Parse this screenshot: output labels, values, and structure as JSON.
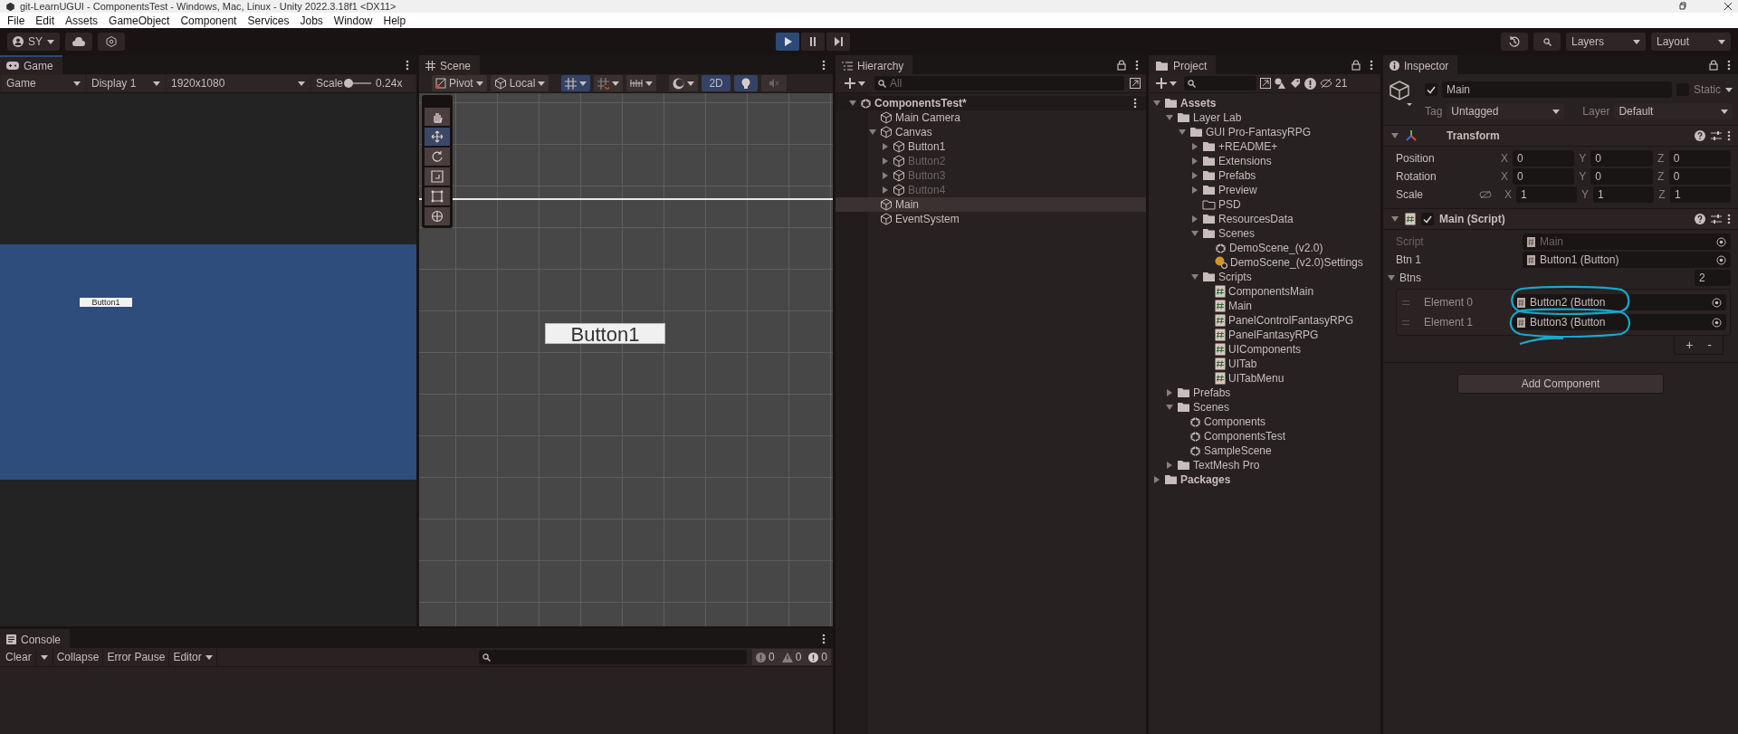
{
  "window": {
    "title": "git-LearnUGUI - ComponentsTest - Windows, Mac, Linux - Unity 2022.3.18f1 <DX11>"
  },
  "menu": [
    "File",
    "Edit",
    "Assets",
    "GameObject",
    "Component",
    "Services",
    "Jobs",
    "Window",
    "Help"
  ],
  "toolbar": {
    "account": "SY",
    "layers": "Layers",
    "layout": "Layout"
  },
  "play_controls": [
    {
      "kind": "play",
      "selected": true
    },
    {
      "kind": "pause",
      "selected": false
    },
    {
      "kind": "step",
      "selected": false
    }
  ],
  "game": {
    "tab": "Game",
    "view_mode": "Game",
    "display": "Display 1",
    "resolution": "1920x1080",
    "scale_label": "Scale",
    "scale_slider": {
      "level": 0.05
    },
    "scale": "0.24x",
    "button_text": "Button1"
  },
  "scene": {
    "tab": "Scene",
    "pivot": "Pivot",
    "local": "Local",
    "mode_2d": {
      "label": "2D",
      "selected": true
    },
    "lighting": {
      "selected": true
    },
    "audio": {
      "selected": false
    },
    "button_text": "Button1",
    "tools": [
      {
        "kind": "hand",
        "selected": false
      },
      {
        "kind": "move",
        "selected": true
      },
      {
        "kind": "rotate",
        "selected": false
      },
      {
        "kind": "scale",
        "selected": false
      },
      {
        "kind": "rect",
        "selected": false
      },
      {
        "kind": "transform",
        "selected": false
      }
    ]
  },
  "hierarchy": {
    "tab": "Hierarchy",
    "search_placeholder": "All",
    "tree": [
      {
        "label": "ComponentsTest*",
        "kind": "scene",
        "expanded": true,
        "selected": false,
        "disabled": false,
        "children": [
          {
            "label": "Main Camera",
            "kind": "object",
            "selected": false,
            "disabled": false
          },
          {
            "label": "Canvas",
            "kind": "object",
            "expanded": true,
            "selected": false,
            "disabled": false,
            "children": [
              {
                "label": "Button1",
                "kind": "object",
                "expanded": false,
                "selected": false,
                "disabled": false
              },
              {
                "label": "Button2",
                "kind": "object",
                "expanded": false,
                "selected": false,
                "disabled": true
              },
              {
                "label": "Button3",
                "kind": "object",
                "expanded": false,
                "selected": false,
                "disabled": true
              },
              {
                "label": "Button4",
                "kind": "object",
                "expanded": false,
                "selected": false,
                "disabled": true
              }
            ]
          },
          {
            "label": "Main",
            "kind": "object",
            "selected": true,
            "disabled": false
          },
          {
            "label": "EventSystem",
            "kind": "object",
            "selected": false,
            "disabled": false
          }
        ]
      }
    ]
  },
  "project": {
    "tab": "Project",
    "hidden_count": "21",
    "tree": [
      {
        "label": "Assets",
        "kind": "folder",
        "expanded": true,
        "children": [
          {
            "label": "Layer Lab",
            "kind": "folder",
            "expanded": true,
            "children": [
              {
                "label": "GUI Pro-FantasyRPG",
                "kind": "folder",
                "expanded": true,
                "children": [
                  {
                    "label": "+README+",
                    "kind": "folder",
                    "expanded": false
                  },
                  {
                    "label": "Extensions",
                    "kind": "folder",
                    "expanded": false
                  },
                  {
                    "label": "Prefabs",
                    "kind": "folder",
                    "expanded": false
                  },
                  {
                    "label": "Preview",
                    "kind": "folder",
                    "expanded": false
                  },
                  {
                    "label": "PSD",
                    "kind": "empty_folder"
                  },
                  {
                    "label": "ResourcesData",
                    "kind": "folder",
                    "expanded": false
                  },
                  {
                    "label": "Scenes",
                    "kind": "folder",
                    "expanded": true,
                    "children": [
                      {
                        "label": "DemoScene_(v2.0)",
                        "kind": "scene"
                      },
                      {
                        "label": "DemoScene_(v2.0)Settings",
                        "kind": "settings"
                      }
                    ]
                  },
                  {
                    "label": "Scripts",
                    "kind": "folder",
                    "expanded": true,
                    "children": [
                      {
                        "label": "ComponentsMain",
                        "kind": "script"
                      },
                      {
                        "label": "Main",
                        "kind": "script"
                      },
                      {
                        "label": "PanelControlFantasyRPG",
                        "kind": "script"
                      },
                      {
                        "label": "PanelFantasyRPG",
                        "kind": "script"
                      },
                      {
                        "label": "UIComponents",
                        "kind": "script"
                      },
                      {
                        "label": "UITab",
                        "kind": "script"
                      },
                      {
                        "label": "UITabMenu",
                        "kind": "script"
                      }
                    ]
                  }
                ]
              }
            ]
          },
          {
            "label": "Prefabs",
            "kind": "folder",
            "expanded": false
          },
          {
            "label": "Scenes",
            "kind": "folder",
            "expanded": true,
            "children": [
              {
                "label": "Components",
                "kind": "scene"
              },
              {
                "label": "ComponentsTest",
                "kind": "scene"
              },
              {
                "label": "SampleScene",
                "kind": "scene"
              }
            ]
          },
          {
            "label": "TextMesh Pro",
            "kind": "folder",
            "expanded": false
          }
        ]
      },
      {
        "label": "Packages",
        "kind": "folder",
        "expanded": false
      }
    ]
  },
  "inspector": {
    "tab": "Inspector",
    "name": "Main",
    "active": true,
    "static": {
      "label": "Static",
      "checked": false
    },
    "tag_label": "Tag",
    "tag": "Untagged",
    "layer_label": "Layer",
    "layer": "Default",
    "transform": {
      "title": "Transform",
      "expanded": true,
      "rows": [
        {
          "label": "Position",
          "fields": [
            {
              "axis": "X",
              "value": "0"
            },
            {
              "axis": "Y",
              "value": "0"
            },
            {
              "axis": "Z",
              "value": "0"
            }
          ]
        },
        {
          "label": "Rotation",
          "fields": [
            {
              "axis": "X",
              "value": "0"
            },
            {
              "axis": "Y",
              "value": "0"
            },
            {
              "axis": "Z",
              "value": "0"
            }
          ]
        },
        {
          "label": "Scale",
          "fields": [
            {
              "axis": "X",
              "value": "1"
            },
            {
              "axis": "Y",
              "value": "1"
            },
            {
              "axis": "Z",
              "value": "1"
            }
          ]
        }
      ]
    },
    "script": {
      "title": "Main (Script)",
      "expanded": true,
      "enabled": true,
      "fields": [
        {
          "label": "Script",
          "value": "Main",
          "disabled": true
        },
        {
          "label": "Btn 1",
          "value": "Button1 (Button)",
          "disabled": false
        }
      ],
      "list": {
        "label": "Btns",
        "expanded": true,
        "count": "2",
        "elements": [
          {
            "label": "Element 0",
            "value": "Button2 (Button"
          },
          {
            "label": "Element 1",
            "value": "Button3 (Button"
          }
        ],
        "add": "+",
        "remove": "-"
      }
    },
    "add_component": "Add Component"
  },
  "console": {
    "tab": "Console",
    "buttons": [
      "Clear",
      "Collapse",
      "Error Pause",
      "Editor"
    ],
    "counts": [
      {
        "kind": "info",
        "value": "0"
      },
      {
        "kind": "warning",
        "value": "0"
      },
      {
        "kind": "error",
        "value": "0"
      }
    ]
  }
}
